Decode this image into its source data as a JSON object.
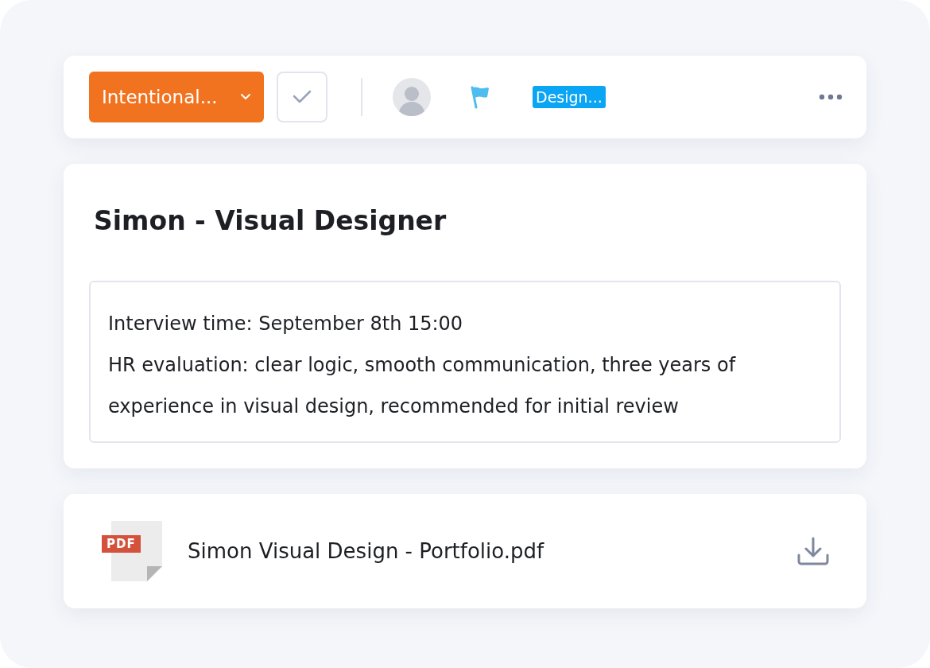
{
  "toolbar": {
    "status": {
      "label": "Intentional..."
    },
    "tag": {
      "label": "Design..."
    }
  },
  "card": {
    "title": "Simon - Visual Designer",
    "notes": [
      "Interview time: September 8th 15:00",
      "HR evaluation: clear logic, smooth communication, three years of experience in visual design, recommended for initial review"
    ]
  },
  "attachment": {
    "file_type": "PDF",
    "name": "Simon Visual Design - Portfolio.pdf"
  }
}
